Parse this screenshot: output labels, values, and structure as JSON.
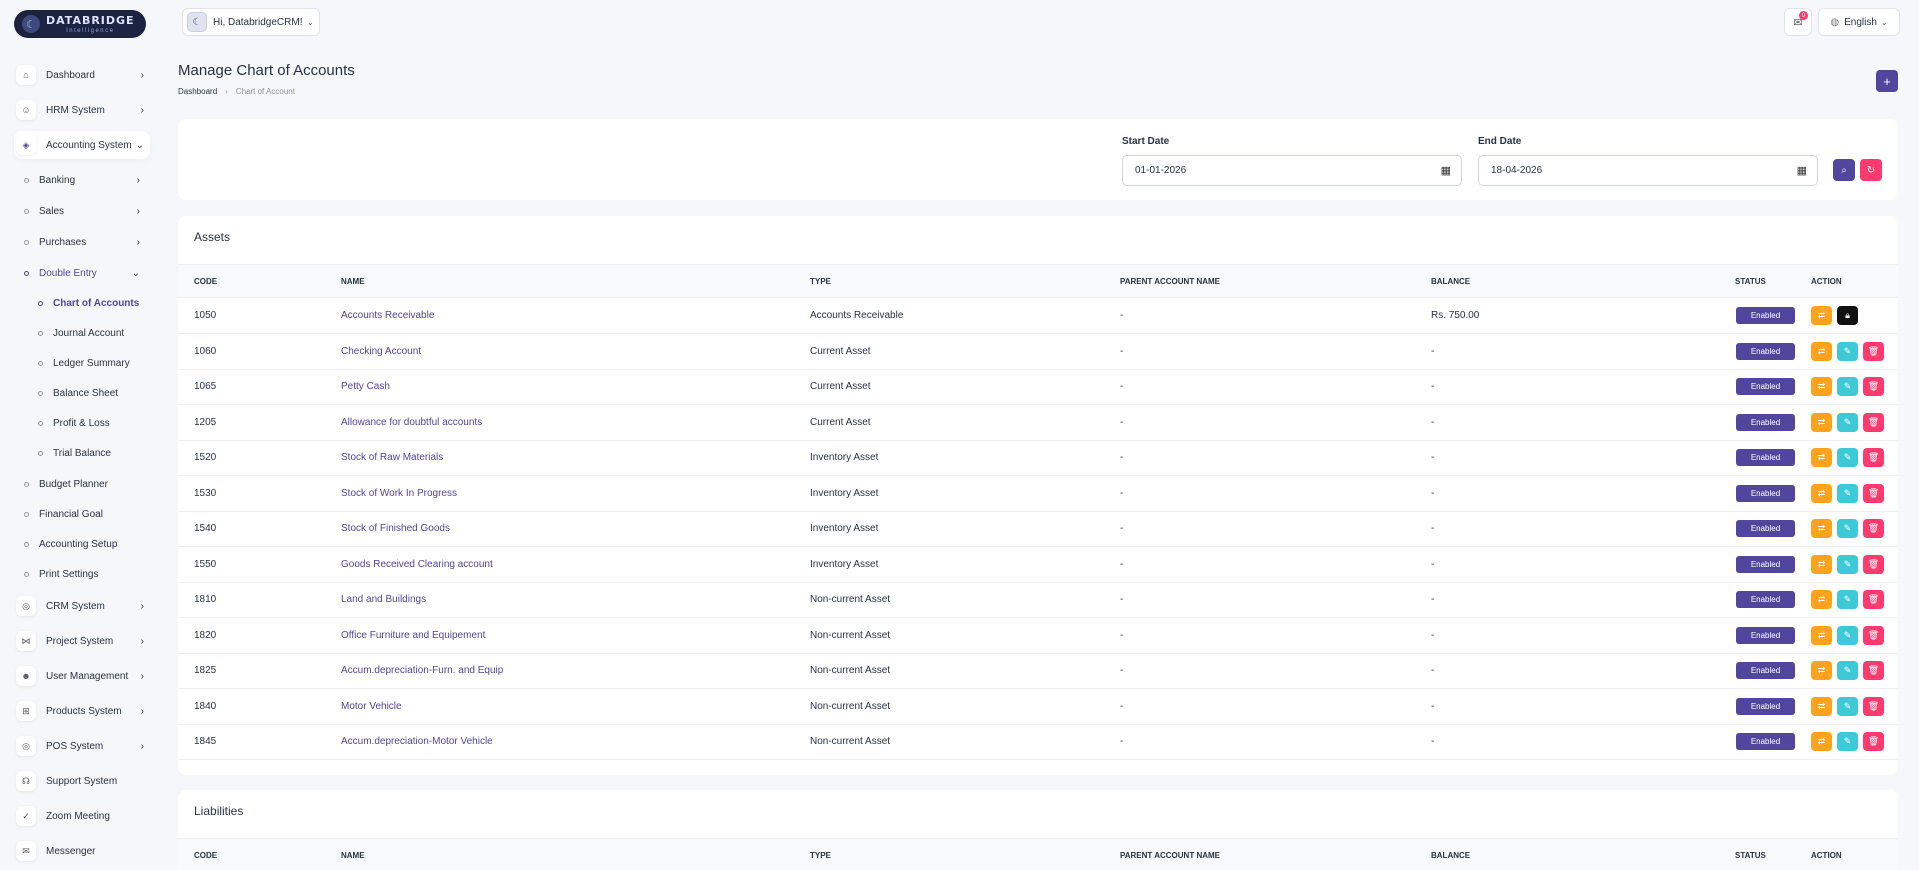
{
  "brand": {
    "name": "DATABRIDGE",
    "tagline": "Intelligence"
  },
  "header": {
    "greeting": "Hi, DatabridgeCRM!",
    "notification_count": "0",
    "language": "English"
  },
  "sidebar": {
    "items": [
      {
        "label": "Dashboard",
        "icon": "home-icon"
      },
      {
        "label": "HRM System",
        "icon": "user-icon"
      },
      {
        "label": "Accounting System",
        "icon": "box-icon"
      },
      {
        "label": "CRM System",
        "icon": "layers-icon"
      },
      {
        "label": "Project System",
        "icon": "share-icon"
      },
      {
        "label": "User Management",
        "icon": "users-icon"
      },
      {
        "label": "Products System",
        "icon": "cart-icon"
      },
      {
        "label": "POS System",
        "icon": "layers-icon"
      },
      {
        "label": "Support System",
        "icon": "headphones-icon"
      },
      {
        "label": "Zoom Meeting",
        "icon": "user-check-icon"
      },
      {
        "label": "Messenger",
        "icon": "message-icon"
      }
    ],
    "accounting_sub": [
      "Banking",
      "Sales",
      "Purchases",
      "Double Entry",
      "Budget Planner",
      "Financial Goal",
      "Accounting Setup",
      "Print Settings"
    ],
    "double_entry_sub": [
      "Chart of Accounts",
      "Journal Account",
      "Ledger Summary",
      "Balance Sheet",
      "Profit & Loss",
      "Trial Balance"
    ]
  },
  "page": {
    "title": "Manage Chart of Accounts",
    "breadcrumb": [
      "Dashboard",
      "Chart of Account"
    ],
    "add_label": "+"
  },
  "filter": {
    "start_label": "Start Date",
    "start_value": "01-01-2026",
    "end_label": "End Date",
    "end_value": "18-04-2026"
  },
  "columns": [
    "CODE",
    "NAME",
    "TYPE",
    "PARENT ACCOUNT NAME",
    "BALANCE",
    "STATUS",
    "ACTION"
  ],
  "assets": {
    "title": "Assets",
    "rows": [
      {
        "code": "1050",
        "name": "Accounts Receivable",
        "type": "Accounts Receivable",
        "parent": "-",
        "balance": "Rs. 750.00",
        "status": "Enabled",
        "locked": true
      },
      {
        "code": "1060",
        "name": "Checking Account",
        "type": "Current Asset",
        "parent": "-",
        "balance": "-",
        "status": "Enabled"
      },
      {
        "code": "1065",
        "name": "Petty Cash",
        "type": "Current Asset",
        "parent": "-",
        "balance": "-",
        "status": "Enabled"
      },
      {
        "code": "1205",
        "name": "Allowance for doubtful accounts",
        "type": "Current Asset",
        "parent": "-",
        "balance": "-",
        "status": "Enabled"
      },
      {
        "code": "1520",
        "name": "Stock of Raw Materials",
        "type": "Inventory Asset",
        "parent": "-",
        "balance": "-",
        "status": "Enabled"
      },
      {
        "code": "1530",
        "name": "Stock of Work In Progress",
        "type": "Inventory Asset",
        "parent": "-",
        "balance": "-",
        "status": "Enabled"
      },
      {
        "code": "1540",
        "name": "Stock of Finished Goods",
        "type": "Inventory Asset",
        "parent": "-",
        "balance": "-",
        "status": "Enabled"
      },
      {
        "code": "1550",
        "name": "Goods Received Clearing account",
        "type": "Inventory Asset",
        "parent": "-",
        "balance": "-",
        "status": "Enabled"
      },
      {
        "code": "1810",
        "name": "Land and Buildings",
        "type": "Non-current Asset",
        "parent": "-",
        "balance": "-",
        "status": "Enabled"
      },
      {
        "code": "1820",
        "name": "Office Furniture and Equipement",
        "type": "Non-current Asset",
        "parent": "-",
        "balance": "-",
        "status": "Enabled"
      },
      {
        "code": "1825",
        "name": "Accum.depreciation-Furn. and Equip",
        "type": "Non-current Asset",
        "parent": "-",
        "balance": "-",
        "status": "Enabled"
      },
      {
        "code": "1840",
        "name": "Motor Vehicle",
        "type": "Non-current Asset",
        "parent": "-",
        "balance": "-",
        "status": "Enabled"
      },
      {
        "code": "1845",
        "name": "Accum.depreciation-Motor Vehicle",
        "type": "Non-current Asset",
        "parent": "-",
        "balance": "-",
        "status": "Enabled"
      }
    ]
  },
  "liabilities": {
    "title": "Liabilities"
  },
  "colors": {
    "primary": "#51459d",
    "orange": "#ffa21d",
    "teal": "#3ec9d6",
    "danger": "#ff3a6e"
  }
}
